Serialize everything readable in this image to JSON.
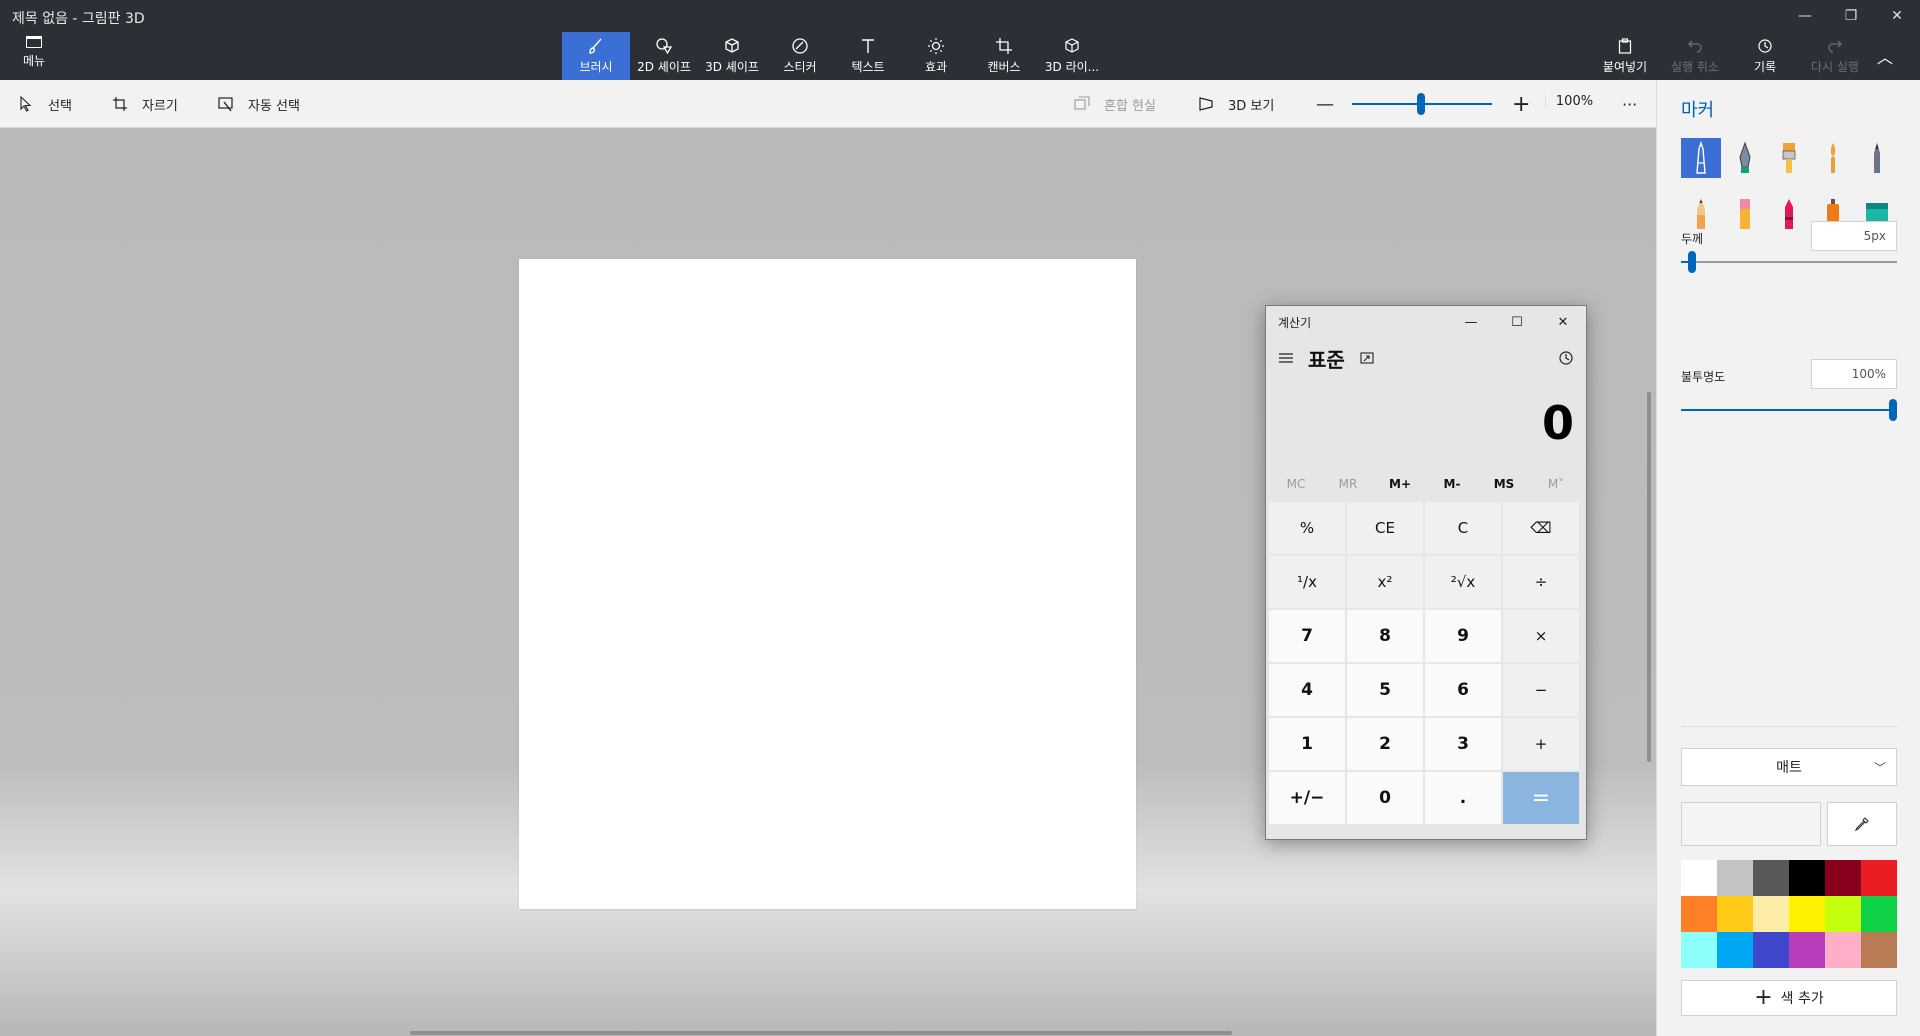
{
  "window": {
    "title": "제목 없음 - 그림판 3D"
  },
  "menu": {
    "label": "메뉴",
    "icon": "folder-icon"
  },
  "tools": [
    {
      "label": "브러시",
      "icon": "brush-icon",
      "active": true
    },
    {
      "label": "2D 셰이프",
      "icon": "2d-shapes-icon"
    },
    {
      "label": "3D 셰이프",
      "icon": "3d-shapes-icon"
    },
    {
      "label": "스티커",
      "icon": "stickers-icon"
    },
    {
      "label": "텍스트",
      "icon": "text-icon"
    },
    {
      "label": "효과",
      "icon": "effects-icon"
    },
    {
      "label": "캔버스",
      "icon": "canvas-icon"
    },
    {
      "label": "3D 라이...",
      "icon": "3d-library-icon"
    }
  ],
  "right_tools": {
    "paste": "붙여넣기",
    "undo": "실행 취소",
    "history": "기록",
    "redo": "다시 실행"
  },
  "commands": {
    "select": "선택",
    "crop": "자르기",
    "magic_select": "자동 선택",
    "mixed_reality": "혼합 현실",
    "view_3d": "3D 보기",
    "zoom_percent": "100%",
    "more": "···"
  },
  "calculator": {
    "title": "계산기",
    "mode": "표준",
    "display": "0",
    "memory": [
      "MC",
      "MR",
      "M+",
      "M-",
      "MS",
      "M˅"
    ],
    "keys": [
      "%",
      "CE",
      "C",
      "⌫",
      "¹/x",
      "x²",
      "²√x",
      "÷",
      "7",
      "8",
      "9",
      "×",
      "4",
      "5",
      "6",
      "−",
      "1",
      "2",
      "3",
      "+",
      "+/−",
      "0",
      ".",
      "="
    ]
  },
  "panel": {
    "title": "마커",
    "thickness_label": "두께",
    "thickness_value": "5px",
    "thickness_level": 0.05,
    "opacity_label": "불투명도",
    "opacity_value": "100%",
    "opacity_level": 1.0,
    "finish": "매트",
    "add_color": "색 추가",
    "palette": [
      "#ffffff",
      "#c3c3c3",
      "#585858",
      "#000000",
      "#88001b",
      "#ec1c24",
      "#ff7f27",
      "#ffca18",
      "#fdeca6",
      "#fff200",
      "#c4ff0e",
      "#0ed145",
      "#8cfffb",
      "#00a8f3",
      "#3f48cc",
      "#b83dba",
      "#ffaec8",
      "#b97a56"
    ]
  }
}
